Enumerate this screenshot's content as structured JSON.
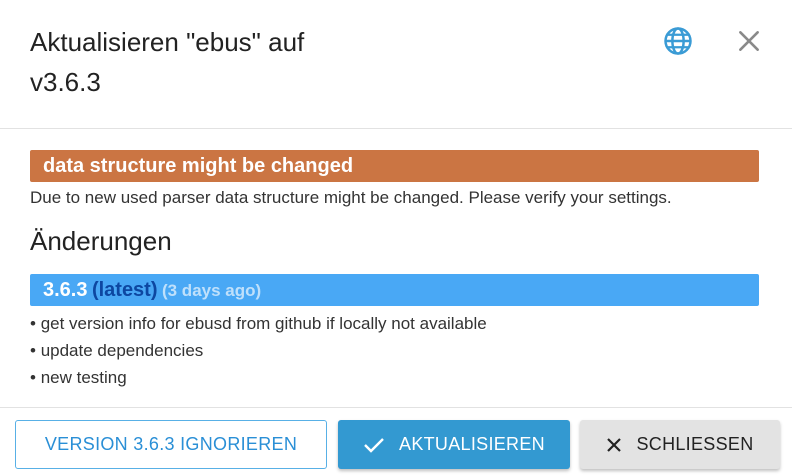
{
  "dialog": {
    "title": "Aktualisieren \"ebus\" auf v3.6.3"
  },
  "warning": {
    "title": "data structure might be changed",
    "text": "Due to new used parser data structure might be changed. Please verify your settings."
  },
  "changelog": {
    "heading": "Änderungen",
    "version": "3.6.3",
    "latest_label": "(latest)",
    "age": "(3 days ago)",
    "items": [
      "get version info for ebusd from github if locally not available",
      "update dependencies",
      "new testing"
    ]
  },
  "buttons": {
    "ignore_label": "VERSION 3.6.3 IGNORIEREN",
    "update_label": "AKTUALISIEREN",
    "close_label": "SCHLIESSEN"
  },
  "icons": {
    "language": "globe-icon",
    "close": "close-icon",
    "update": "check-icon",
    "cancel": "x-icon"
  },
  "colors": {
    "warning": "#cb7543",
    "version_bar": "#49a8f5",
    "latest_text": "#0d47a1",
    "primary": "#3399d1"
  }
}
